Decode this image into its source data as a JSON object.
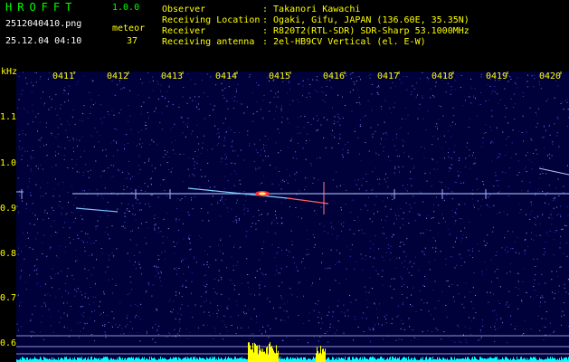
{
  "app": {
    "title": "HROFFT",
    "version": "1.0.0"
  },
  "file": {
    "name": "2512040410.png",
    "datetime": "25.12.04 04:10"
  },
  "meteor": {
    "label": "meteor",
    "count": "37"
  },
  "station": [
    {
      "key": "Observer",
      "value": ": Takanori Kawachi"
    },
    {
      "key": "Receiving Location",
      "value": ": Ogaki, Gifu, JAPAN (136.60E, 35.35N)"
    },
    {
      "key": "Receiver",
      "value": ": R820T2(RTL-SDR) SDR-Sharp 53.1000MHz"
    },
    {
      "key": "Receiving antenna",
      "value": ": 2el-HB9CV Vertical (el. E-W)"
    }
  ],
  "axis": {
    "unit": "kHz",
    "time_ticks": [
      "0411",
      "0412",
      "0413",
      "0414",
      "0415",
      "0416",
      "0417",
      "0418",
      "0419",
      "0420"
    ],
    "freq_ticks": [
      "1.1",
      "1.0",
      "0.9",
      "0.8",
      "0.7",
      "0.6"
    ]
  },
  "colors": {
    "label": "#ffff00",
    "title": "#00ff00",
    "bg": "#00003a",
    "bars": "#00ffff"
  }
}
